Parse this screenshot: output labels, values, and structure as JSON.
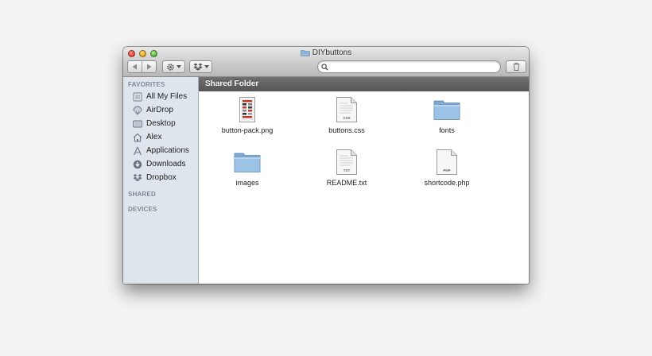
{
  "window": {
    "title": "DIYbuttons"
  },
  "toolbar": {
    "back_icon": "back-arrow-icon",
    "forward_icon": "forward-arrow-icon",
    "action_icon": "gear-icon",
    "dropbox_icon": "dropbox-icon",
    "search_icon": "search-icon",
    "trash_icon": "trash-icon",
    "search": {
      "value": "",
      "placeholder": ""
    }
  },
  "sidebar": {
    "favorites_heading": "FAVORITES",
    "items": [
      {
        "label": "All My Files",
        "icon": "all-files-icon"
      },
      {
        "label": "AirDrop",
        "icon": "airdrop-icon"
      },
      {
        "label": "Desktop",
        "icon": "desktop-icon"
      },
      {
        "label": "Alex",
        "icon": "home-icon"
      },
      {
        "label": "Applications",
        "icon": "applications-icon"
      },
      {
        "label": "Downloads",
        "icon": "downloads-icon"
      },
      {
        "label": "Dropbox",
        "icon": "dropbox-icon"
      }
    ],
    "shared_heading": "SHARED",
    "devices_heading": "DEVICES"
  },
  "content": {
    "path_label": "Shared Folder",
    "files": [
      {
        "name": "button-pack.png",
        "kind": "image-file-icon"
      },
      {
        "name": "buttons.css",
        "kind": "document-icon",
        "badge": "CSS"
      },
      {
        "name": "fonts",
        "kind": "folder-icon"
      },
      {
        "name": "images",
        "kind": "folder-icon"
      },
      {
        "name": "README.txt",
        "kind": "document-icon",
        "badge": "TXT"
      },
      {
        "name": "shortcode.php",
        "kind": "document-icon",
        "badge": "PHP"
      }
    ]
  },
  "colors": {
    "sidebar_bg": "#dfe5ec",
    "pathbar_bg": "#5e5e5e",
    "folder_blue": "#8fb6d9",
    "close": "#e0443a",
    "minimize": "#e5a21f",
    "maximize": "#5cb838"
  }
}
